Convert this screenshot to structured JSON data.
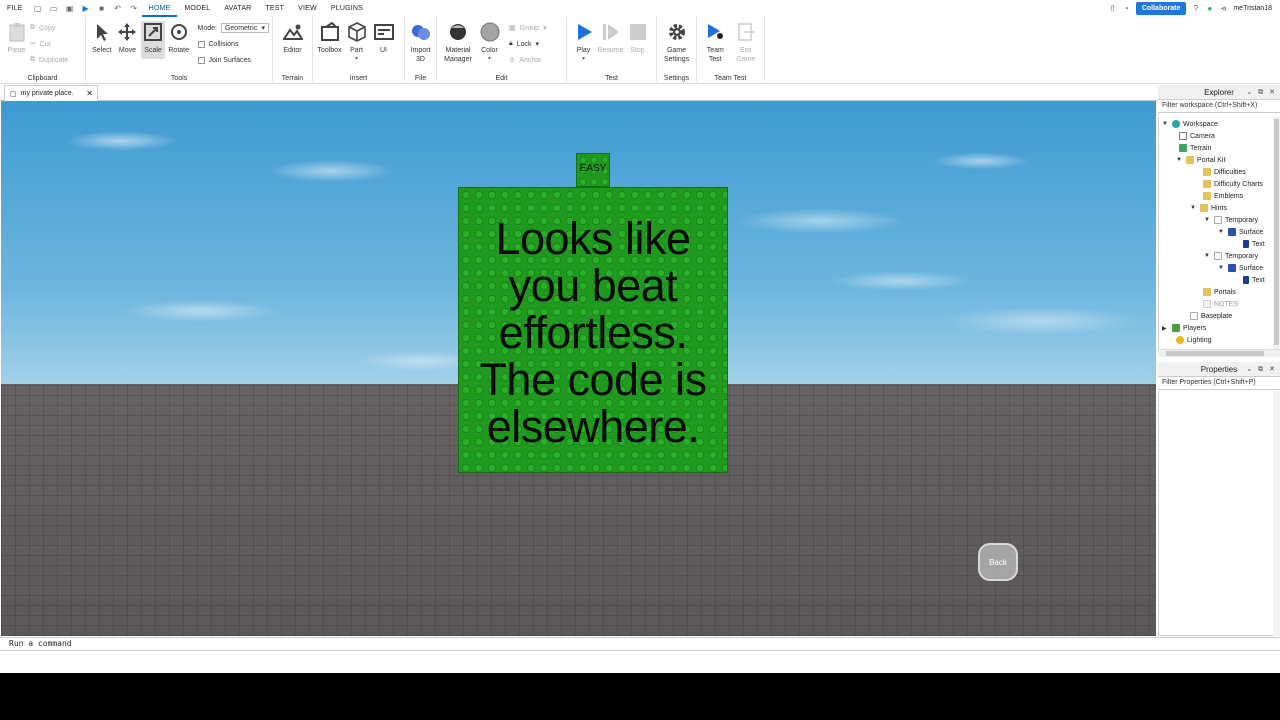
{
  "menubar": {
    "file": "FILE",
    "tabs": [
      "HOME",
      "MODEL",
      "AVATAR",
      "TEST",
      "VIEW",
      "PLUGINS"
    ],
    "active_tab": "HOME",
    "collaborate": "Collaborate",
    "username": "meTristan18"
  },
  "ribbon": {
    "clipboard": {
      "label": "Clipboard",
      "paste": "Paste",
      "copy": "Copy",
      "cut": "Cut",
      "duplicate": "Duplicate"
    },
    "tools": {
      "label": "Tools",
      "select": "Select",
      "move": "Move",
      "scale": "Scale",
      "rotate": "Rotate",
      "mode_label": "Mode:",
      "mode_value": "Geometric",
      "collisions": "Collisions",
      "join_surfaces": "Join Surfaces"
    },
    "terrain": {
      "label": "Terrain",
      "editor": "Editor"
    },
    "insert": {
      "label": "Insert",
      "toolbox": "Toolbox",
      "part": "Part",
      "ui": "UI"
    },
    "file": {
      "label": "File",
      "import3d_1": "Import",
      "import3d_2": "3D"
    },
    "edit": {
      "label": "Edit",
      "material_1": "Material",
      "material_2": "Manager",
      "color": "Color",
      "group": "Group",
      "lock": "Lock",
      "anchor": "Anchor"
    },
    "test": {
      "label": "Test",
      "play": "Play",
      "resume": "Resume",
      "stop": "Stop"
    },
    "settings": {
      "label": "Settings",
      "game_1": "Game",
      "game_2": "Settings"
    },
    "teamtest": {
      "label": "Team Test",
      "team_1": "Team",
      "team_2": "Test",
      "exit_1": "Exit",
      "exit_2": "Game"
    }
  },
  "doc_tab": {
    "title": "my private place."
  },
  "viewport": {
    "easy_tag": "EASY",
    "sign_lines": [
      "Looks like",
      "you beat",
      "effortless.",
      "The code is",
      "elsewhere."
    ],
    "back": "Back"
  },
  "command_bar": {
    "placeholder": "Run a command"
  },
  "explorer": {
    "title": "Explorer",
    "filter": "Filter workspace (Ctrl+Shift+X)",
    "items": [
      {
        "label": "Workspace"
      },
      {
        "label": "Camera"
      },
      {
        "label": "Terrain"
      },
      {
        "label": "Portal Kit"
      },
      {
        "label": "Difficulties"
      },
      {
        "label": "Difficulty Charts"
      },
      {
        "label": "Emblems"
      },
      {
        "label": "Hints"
      },
      {
        "label": "Temporary"
      },
      {
        "label": "Surface"
      },
      {
        "label": "Text"
      },
      {
        "label": "Temporary"
      },
      {
        "label": "Surface"
      },
      {
        "label": "Text"
      },
      {
        "label": "Portals"
      },
      {
        "label": "NOTES"
      },
      {
        "label": "Baseplate"
      },
      {
        "label": "Players"
      },
      {
        "label": "Lighting"
      }
    ]
  },
  "properties": {
    "title": "Properties",
    "filter": "Filter Properties (Ctrl+Shift+P)"
  }
}
